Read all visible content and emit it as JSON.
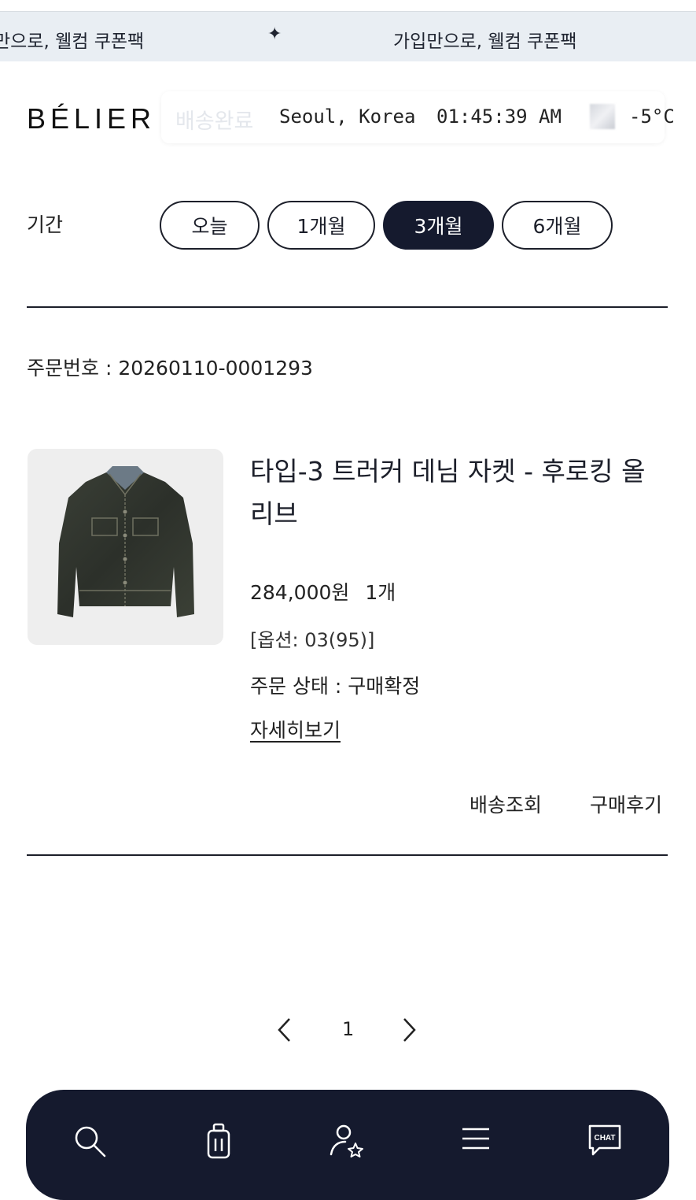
{
  "banner": {
    "text_left": "만으로, 웰컴 쿠폰팩",
    "star": "✦",
    "text_right": "가입만으로, 웰컴 쿠폰팩"
  },
  "header": {
    "logo": "BÉLIER",
    "ghost_text": "배송완료",
    "city": "Seoul, Korea",
    "time": "01:45:39 AM",
    "temperature": "-5°C"
  },
  "filter": {
    "label": "기간",
    "options": [
      "오늘",
      "1개월",
      "3개월",
      "6개월"
    ],
    "selected": "3개월"
  },
  "order": {
    "order_number": "주문번호 : 20260110-0001293",
    "product_name": "타입-3 트러커 데님 자켓 - 후로킹 올리브",
    "price": "284,000원",
    "quantity": "1개",
    "option": "[옵션: 03(95)]",
    "status": "주문 상태 : 구매확정",
    "detail_link": "자세히보기",
    "actions": [
      "배송조회",
      "구매후기"
    ]
  },
  "pagination": {
    "current_page": "1"
  },
  "bottom_nav": {
    "items": [
      "search-icon",
      "shopping-bag-icon",
      "user-star-icon",
      "menu-icon",
      "chat-icon"
    ],
    "chat_label": "CHAT"
  },
  "colors": {
    "banner_bg": "#e9eef3",
    "navy": "#151a2e",
    "text": "#1c1f2a"
  }
}
